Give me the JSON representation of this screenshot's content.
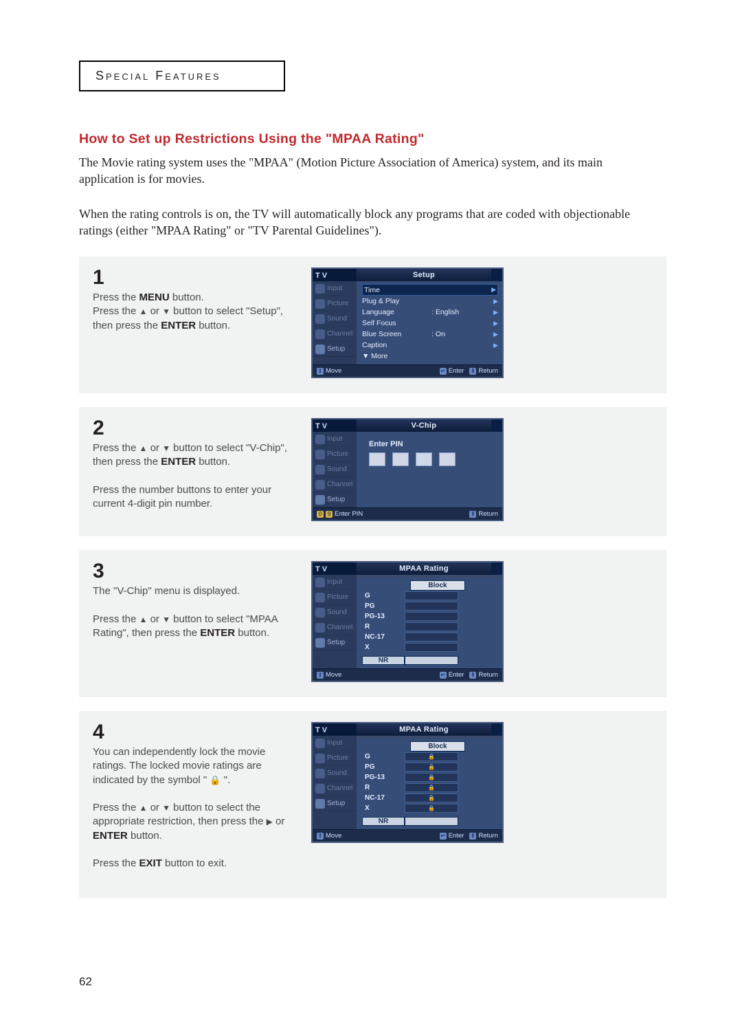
{
  "page_number": "62",
  "header": "Special Features",
  "title": "How to Set up Restrictions Using the \"MPAA Rating\"",
  "intro1": "The Movie rating system uses the \"MPAA\" (Motion Picture Association of America) system, and its main application is for movies.",
  "intro2": "When the rating controls is on, the TV will automatically block any programs that are coded with objectionable ratings (either \"MPAA Rating\" or \"TV Parental Guidelines\").",
  "steps": {
    "s1": {
      "num": "1",
      "l1a": "Press the ",
      "l1b": "MENU",
      "l1c": " button.",
      "l2a": "Press the ",
      "l2b": " or ",
      "l2c": " button to select \"Setup\", then press the ",
      "l2d": "ENTER",
      "l2e": " button."
    },
    "s2": {
      "num": "2",
      "l1a": "Press the ",
      "l1b": " or ",
      "l1c": " button to select \"V-Chip\", then press the ",
      "l1d": "ENTER",
      "l1e": " button.",
      "l2": "Press the number buttons to enter your current 4-digit pin number."
    },
    "s3": {
      "num": "3",
      "l1": "The \"V-Chip\" menu is displayed.",
      "l2a": "Press the ",
      "l2b": " or ",
      "l2c": " button to select \"MPAA Rating\", then press the ",
      "l2d": "ENTER",
      "l2e": " button."
    },
    "s4": {
      "num": "4",
      "l1a": "You can independently lock the movie ratings. The locked movie ratings are indicated by the symbol \" ",
      "l1b": " \".",
      "l2a": "Press the ",
      "l2b": " or ",
      "l2c": " button to select the appropriate restriction, then press  the ",
      "l2d": " or ",
      "l2e": "ENTER",
      "l2f": " button.",
      "l3a": "Press the ",
      "l3b": "EXIT",
      "l3c": " button to exit."
    }
  },
  "tv": {
    "label": "T V",
    "side": {
      "input": "Input",
      "picture": "Picture",
      "sound": "Sound",
      "channel": "Channel",
      "setup": "Setup"
    },
    "help": {
      "move": "Move",
      "enter": "Enter",
      "return": "Return",
      "enterpin": "Enter PIN"
    },
    "screen1": {
      "title": "Setup",
      "rows": {
        "time": "Time",
        "plug": "Plug & Play",
        "lang": "Language",
        "lang_val": ":   English",
        "self": "Self Focus",
        "blue": "Blue Screen",
        "blue_val": ":   On",
        "caption": "Caption",
        "more": "▼ More"
      }
    },
    "screen2": {
      "title": "V-Chip",
      "enterpin": "Enter PIN"
    },
    "screen3": {
      "title": "MPAA Rating",
      "block": "Block",
      "ratings": {
        "g": "G",
        "pg": "PG",
        "pg13": "PG-13",
        "r": "R",
        "nc17": "NC-17",
        "x": "X",
        "nr": "NR"
      }
    },
    "screen4": {
      "title": "MPAA Rating",
      "block": "Block"
    }
  }
}
